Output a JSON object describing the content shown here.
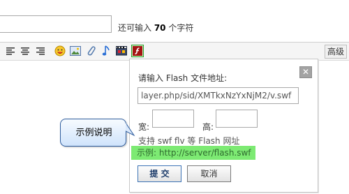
{
  "title_field": {
    "value": ""
  },
  "char_counter": {
    "prefix": "还可输入 ",
    "count": "70",
    "suffix": " 个字符"
  },
  "toolbar": {
    "icons": [
      "align-left-icon",
      "align-center-icon",
      "align-right-icon",
      "emoticon-icon",
      "image-icon",
      "attachment-icon",
      "music-icon",
      "video-icon",
      "flash-icon"
    ],
    "advanced_label": "高级",
    "active_color": "#c9f7c0"
  },
  "flash_dialog": {
    "title": "请输入 Flash 文件地址:",
    "url_value": "layer.php/sid/XMTkxNzYxNjM2/v.swf",
    "width_label": "宽:",
    "height_label": "高:",
    "support_text": "支持 swf flv 等 Flash 网址",
    "example_text": "示例: http://server/flash.swf",
    "example_highlight": "#7dea73",
    "submit_label": "提 交",
    "cancel_label": "取消",
    "close_symbol": "✕"
  },
  "annotation": {
    "text": "示例说明",
    "border_color": "#2e5d9e"
  }
}
